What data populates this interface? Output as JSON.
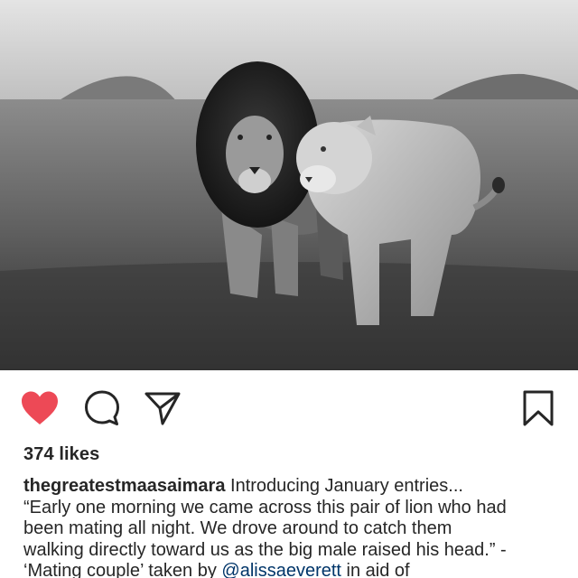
{
  "photo": {
    "description_icon": "lion-photo"
  },
  "actions": {
    "like_icon": "heart-filled-icon",
    "like_color": "#ed4956",
    "comment_icon": "comment-bubble-icon",
    "share_icon": "paper-plane-icon",
    "save_icon": "bookmark-icon"
  },
  "post": {
    "likes": "374 likes",
    "caption": {
      "username": "thegreatestmaasaimara",
      "line1_rest": " Introducing January entries...",
      "line2": "“Early one morning we came across this pair of lion who had",
      "line3": "been mating all night. We drove around to catch them",
      "line4": "walking directly toward us as the big male raised his head.” -",
      "line5_pre": "‘Mating couple’ taken by ",
      "mention": "@alissaeverett",
      "line5_post": " in aid of"
    }
  }
}
